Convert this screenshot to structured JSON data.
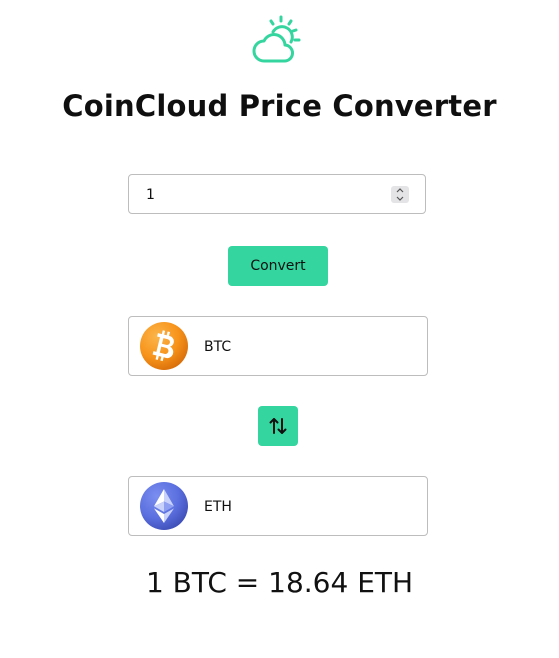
{
  "app": {
    "title": "CoinCloud Price Converter",
    "logo_icon": "cloud-sun-icon",
    "accent_color": "#34d59f"
  },
  "converter": {
    "amount_value": "1",
    "convert_label": "Convert",
    "from_coin": {
      "symbol": "BTC",
      "icon": "bitcoin-icon"
    },
    "swap_icon": "swap-arrows-icon",
    "to_coin": {
      "symbol": "ETH",
      "icon": "ethereum-icon"
    },
    "result_text": "1 BTC = 18.64 ETH"
  }
}
